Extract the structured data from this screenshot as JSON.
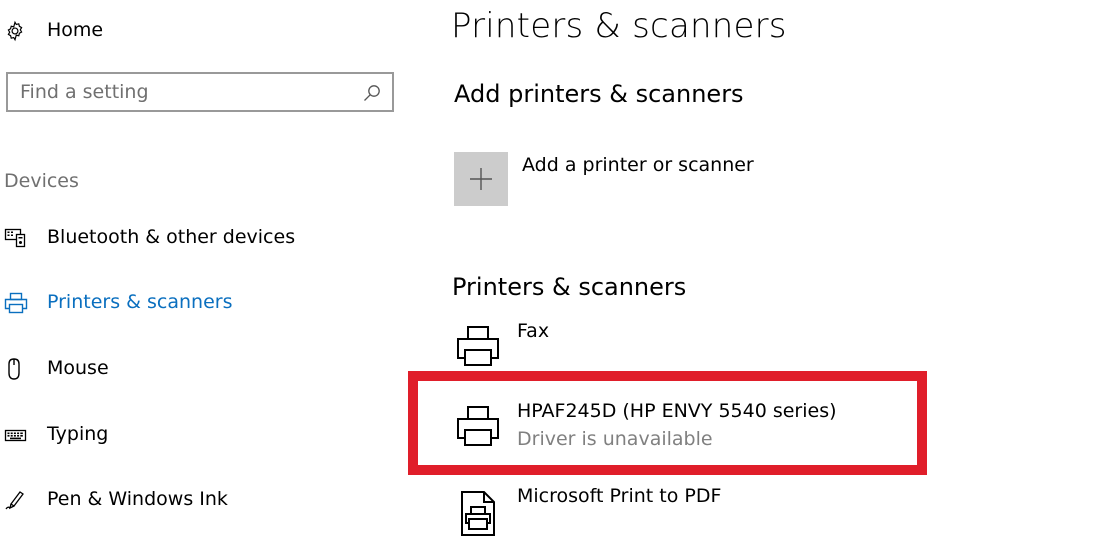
{
  "sidebar": {
    "home_label": "Home",
    "search_placeholder": "Find a setting",
    "search_value": "",
    "section_label": "Devices",
    "items": [
      {
        "label": "Bluetooth & other devices",
        "icon": "bluetooth-devices-icon",
        "active": false
      },
      {
        "label": "Printers & scanners",
        "icon": "printer-icon",
        "active": true
      },
      {
        "label": "Mouse",
        "icon": "mouse-icon",
        "active": false
      },
      {
        "label": "Typing",
        "icon": "keyboard-icon",
        "active": false
      },
      {
        "label": "Pen & Windows Ink",
        "icon": "pen-icon",
        "active": false
      }
    ]
  },
  "main": {
    "title": "Printers & scanners",
    "add_section": {
      "heading": "Add printers & scanners",
      "add_label": "Add a printer or scanner",
      "icon": "plus-icon"
    },
    "devices_section": {
      "heading": "Printers & scanners",
      "devices": [
        {
          "name": "Fax",
          "status": "",
          "icon": "printer-icon"
        },
        {
          "name": "HPAF245D (HP ENVY 5540 series)",
          "status": "Driver is unavailable",
          "icon": "printer-icon"
        },
        {
          "name": "Microsoft Print to PDF",
          "status": "",
          "icon": "pdf-printer-icon"
        }
      ]
    }
  },
  "colors": {
    "accent": "#0a6fbf",
    "highlight": "#e01e2a",
    "secondary_text": "#808080",
    "tile": "#cccccc"
  }
}
